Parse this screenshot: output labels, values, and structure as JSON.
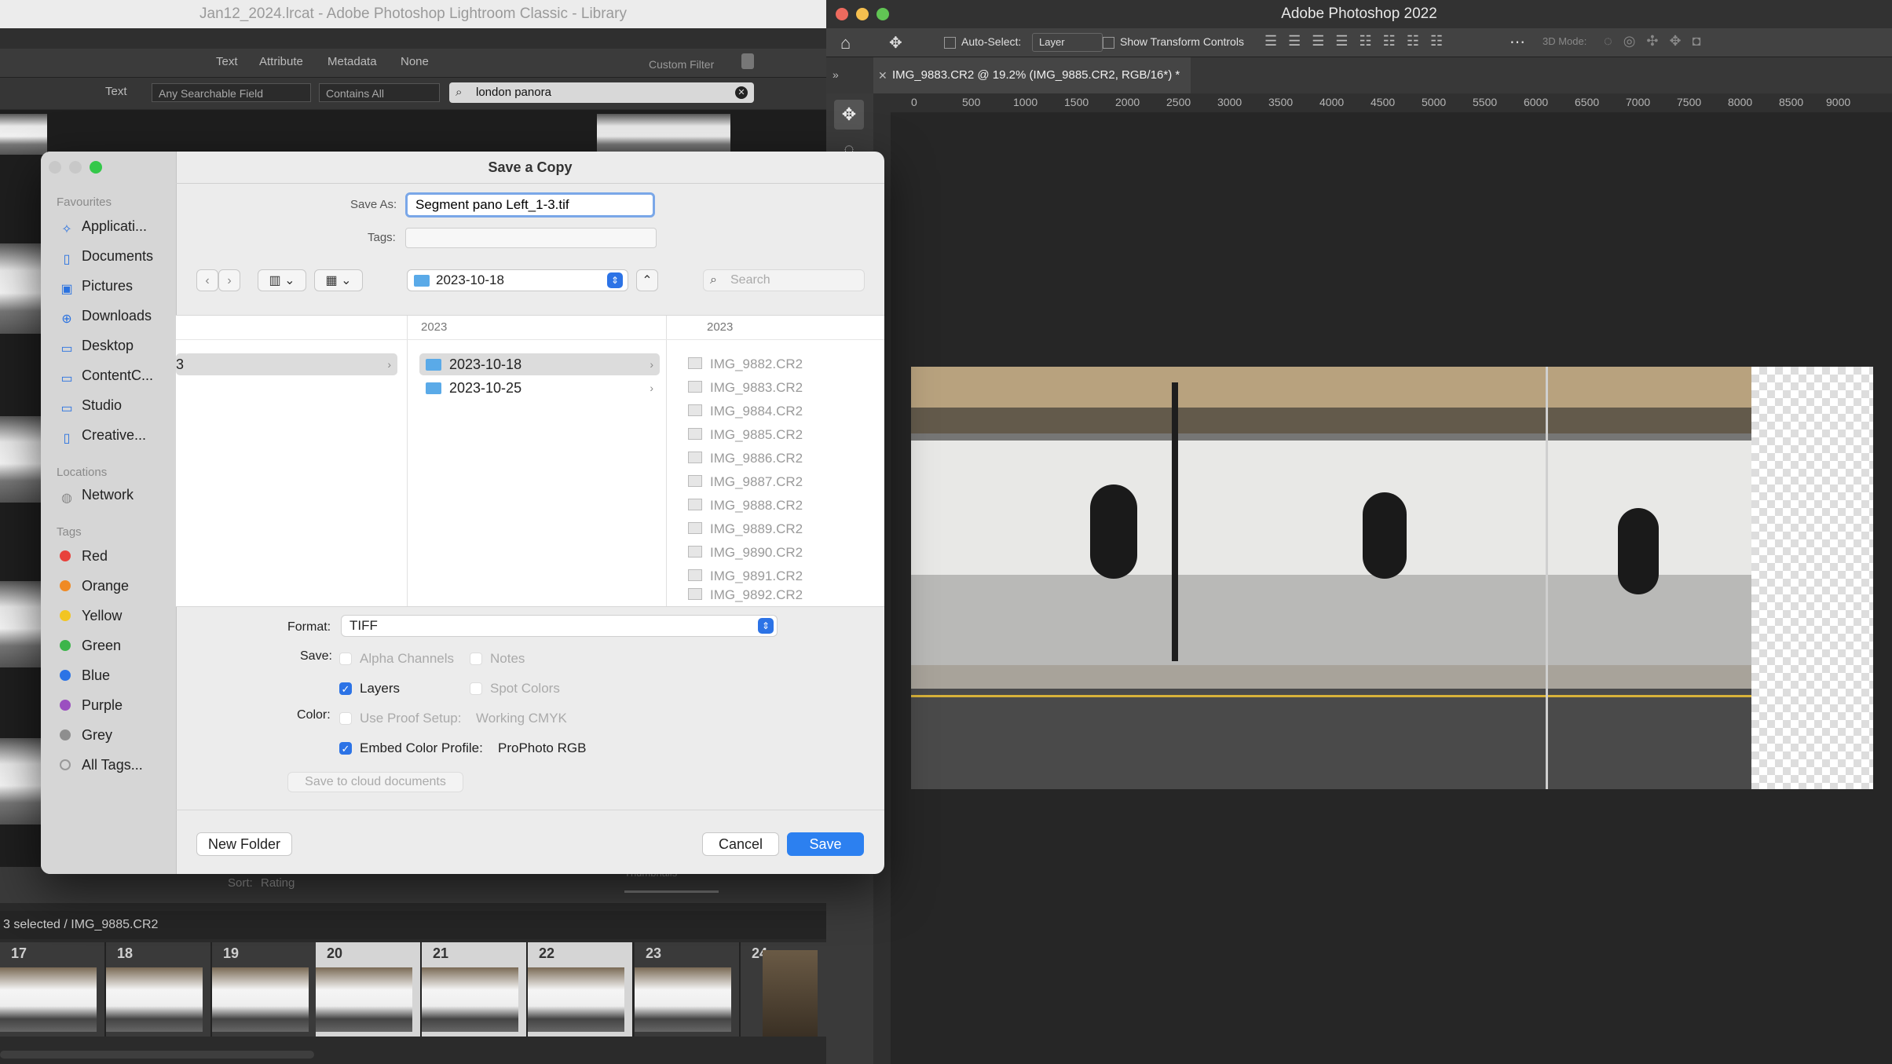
{
  "lightroom": {
    "window_title": "Jan12_2024.lrcat - Adobe Photoshop Lightroom Classic - Library",
    "filter_tabs": [
      "Text",
      "Attribute",
      "Metadata",
      "None"
    ],
    "custom_filter": "Custom Filter",
    "text_label": "Text",
    "field_select": "Any Searchable Field",
    "rule_select": "Contains All",
    "search_value": "london panora",
    "sort_label": "Sort:",
    "sort_value": "Rating",
    "thumbnails_label": "Thumbnails",
    "status_text": "3 selected / IMG_9885.CR2",
    "filmstrip": [
      {
        "num": "17"
      },
      {
        "num": "18"
      },
      {
        "num": "19"
      },
      {
        "num": "20"
      },
      {
        "num": "21"
      },
      {
        "num": "22"
      },
      {
        "num": "23"
      },
      {
        "num": "24"
      }
    ]
  },
  "photoshop": {
    "window_title": "Adobe Photoshop 2022",
    "auto_select_label": "Auto-Select:",
    "auto_select_value": "Layer",
    "transform_label": "Show Transform Controls",
    "mode_3d": "3D Mode:",
    "doc_tab": "IMG_9883.CR2 @ 19.2% (IMG_9885.CR2, RGB/16*) *",
    "ruler_ticks": [
      "0",
      "500",
      "1000",
      "1500",
      "2000",
      "2500",
      "3000",
      "3500",
      "4000",
      "4500",
      "5000",
      "5500",
      "6000",
      "6500",
      "7000",
      "7500",
      "8000",
      "8500",
      "9000"
    ]
  },
  "dialog": {
    "title": "Save a Copy",
    "save_as_label": "Save As:",
    "save_as_value": "Segment pano Left_1-3.tif",
    "tags_label": "Tags:",
    "path_folder": "2023-10-18",
    "search_placeholder": "Search",
    "sidebar": {
      "favourites_header": "Favourites",
      "favourites": [
        {
          "label": "Applicati...",
          "icon": "applications-icon"
        },
        {
          "label": "Documents",
          "icon": "document-icon"
        },
        {
          "label": "Pictures",
          "icon": "pictures-icon"
        },
        {
          "label": "Downloads",
          "icon": "downloads-icon"
        },
        {
          "label": "Desktop",
          "icon": "desktop-icon"
        },
        {
          "label": "ContentC...",
          "icon": "folder-icon"
        },
        {
          "label": "Studio",
          "icon": "folder-icon"
        },
        {
          "label": "Creative...",
          "icon": "document-icon"
        }
      ],
      "locations_header": "Locations",
      "locations": [
        {
          "label": "Network",
          "icon": "network-icon"
        }
      ],
      "tags_header": "Tags",
      "tags": [
        {
          "label": "Red",
          "color": "#e8413b"
        },
        {
          "label": "Orange",
          "color": "#f08a24"
        },
        {
          "label": "Yellow",
          "color": "#f2c523"
        },
        {
          "label": "Green",
          "color": "#3cb54a"
        },
        {
          "label": "Blue",
          "color": "#2c73e6"
        },
        {
          "label": "Purple",
          "color": "#9b4fc0"
        },
        {
          "label": "Grey",
          "color": "#8e8e8e"
        },
        {
          "label": "All Tags...",
          "color": "none"
        }
      ]
    },
    "browser": {
      "col1_item": "3",
      "col2_header": "2023",
      "col2_items": [
        "2023-10-18",
        "2023-10-25"
      ],
      "col3_header": "2023",
      "col3_items": [
        "IMG_9882.CR2",
        "IMG_9883.CR2",
        "IMG_9884.CR2",
        "IMG_9885.CR2",
        "IMG_9886.CR2",
        "IMG_9887.CR2",
        "IMG_9888.CR2",
        "IMG_9889.CR2",
        "IMG_9890.CR2",
        "IMG_9891.CR2",
        "IMG_9892.CR2"
      ]
    },
    "format_label": "Format:",
    "format_value": "TIFF",
    "save_label": "Save:",
    "alpha_channels": "Alpha Channels",
    "notes": "Notes",
    "layers": "Layers",
    "spot_colors": "Spot Colors",
    "color_label": "Color:",
    "use_proof": "Use Proof Setup:",
    "working_cmyk": "Working CMYK",
    "embed_profile": "Embed Color Profile:",
    "profile_value": "ProPhoto RGB",
    "cloud_button": "Save to cloud documents",
    "new_folder": "New Folder",
    "cancel": "Cancel",
    "save": "Save"
  }
}
